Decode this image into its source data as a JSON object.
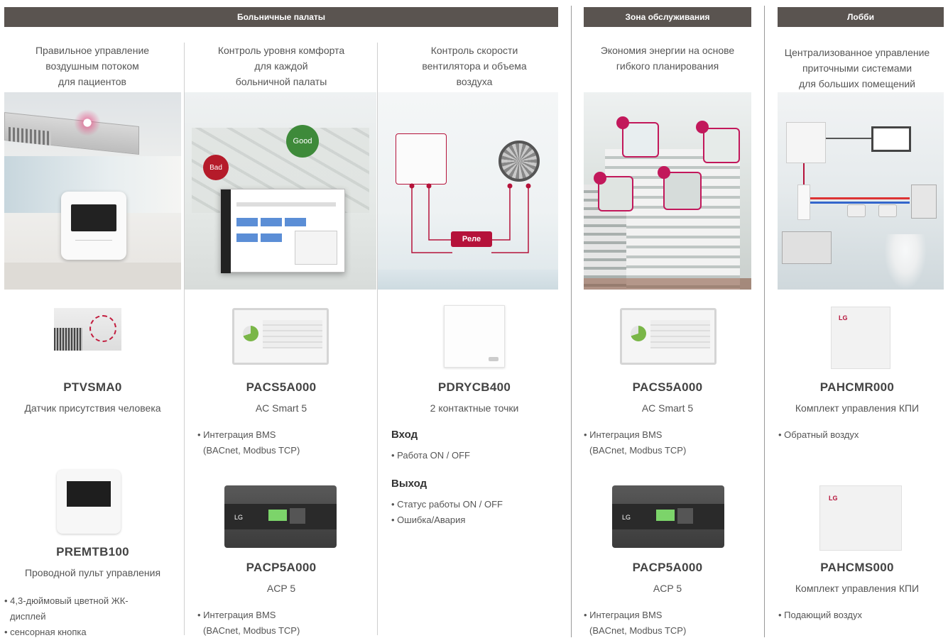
{
  "headers": {
    "wards": "Больничные палаты",
    "service": "Зона обслуживания",
    "lobby": "Лобби"
  },
  "columns": [
    {
      "intro": [
        "Правильное управление",
        "воздушным потоком",
        "для пациентов"
      ],
      "products": [
        {
          "code": "PTVSMA0",
          "desc": "Датчик присутствия человека",
          "bullets": []
        },
        {
          "code": "PREMTB100",
          "desc": "Проводной пульт управления",
          "bullets": [
            "• 4,3-дюймовый цветной ЖК-",
            "  дисплей",
            "• сенсорная кнопка"
          ]
        }
      ]
    },
    {
      "intro": [
        "Контроль уровня комфорта",
        "для каждой",
        "больничной палаты"
      ],
      "badges": {
        "good": "Good",
        "bad": "Bad"
      },
      "products": [
        {
          "code": "PACS5A000",
          "desc": "AC Smart 5",
          "bullets": [
            "• Интеграция BMS",
            "  (BACnet, Modbus TCP)"
          ]
        },
        {
          "code": "PACP5A000",
          "desc": "ACP 5",
          "bullets": [
            "• Интеграция BMS",
            "  (BACnet, Modbus TCP)"
          ]
        }
      ]
    },
    {
      "intro": [
        "Контроль скорости",
        "вентилятора и объема",
        "воздуха"
      ],
      "relay": "Реле",
      "products": [
        {
          "code": "PDRYCB400",
          "desc": "2 контактные точки"
        }
      ],
      "input_title": "Вход",
      "input_bullets": [
        "• Работа ON / OFF"
      ],
      "output_title": "Выход",
      "output_bullets": [
        "• Статус работы ON / OFF",
        "• Ошибка/Авария"
      ]
    },
    {
      "intro": [
        "Экономия энергии на основе",
        "гибкого планирования"
      ],
      "products": [
        {
          "code": "PACS5A000",
          "desc": "AC Smart 5",
          "bullets": [
            "• Интеграция BMS",
            "  (BACnet, Modbus TCP)"
          ]
        },
        {
          "code": "PACP5A000",
          "desc": "ACP 5",
          "bullets": [
            "• Интеграция BMS",
            "  (BACnet, Modbus TCP)"
          ]
        }
      ]
    },
    {
      "intro": [
        "Централизованное управление",
        "приточными системами",
        "для больших помещений"
      ],
      "products": [
        {
          "code": "PAHCMR000",
          "desc": "Комплект управления КПИ",
          "bullets": [
            "• Обратный воздух"
          ]
        },
        {
          "code": "PAHCMS000",
          "desc": "Комплект управления КПИ",
          "bullets": [
            "• Подающий воздух"
          ]
        }
      ]
    }
  ],
  "brand_logo": "LG",
  "colors": {
    "header_bg": "#5a5450",
    "accent": "#b5123a",
    "text": "#555555"
  }
}
